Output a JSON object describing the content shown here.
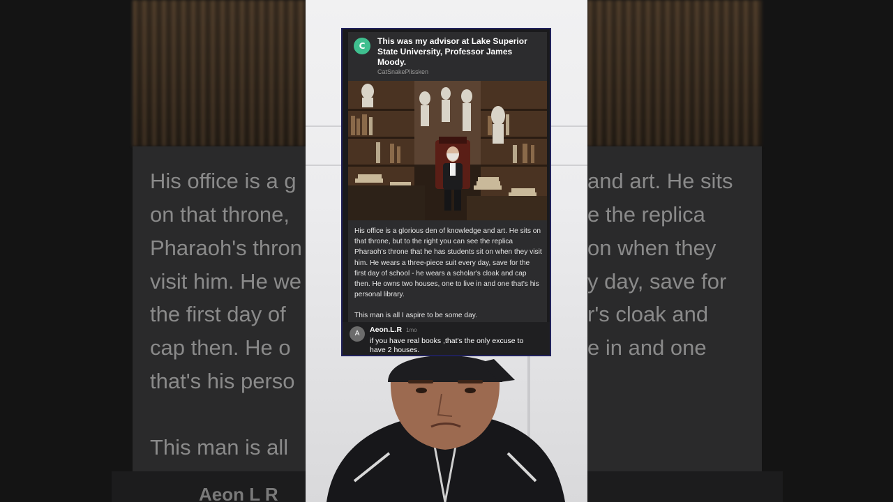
{
  "post": {
    "avatar_letter": "C",
    "title": "This was my advisor at Lake Superior State University, Professor James Moody.",
    "author": "CatSnakePlissken",
    "image_alt": "Professor seated in an office full of books, busts and statues",
    "body_paragraphs": [
      "His office is a glorious den of knowledge and art. He sits on that throne, but to the right you can see the replica Pharaoh's throne that he has students sit on when they visit him. He wears a three-piece suit every day, save for the first day of school - he wears a scholar's cloak and cap then. He owns two houses, one to live in and one that's his personal library.",
      "This man is all I aspire to be some day."
    ]
  },
  "comment": {
    "avatar_letter": "A",
    "username": "Aeon.L.R",
    "time": "1mo",
    "text": "if you have real books ,that's the only excuse to have 2 houses."
  },
  "background_blur": {
    "left_lines": [
      "His office is a g",
      "on that throne,",
      "Pharaoh's thron",
      "visit him. He we",
      "the first day of",
      "cap then. He o",
      "that's his perso"
    ],
    "left_last": "This man is all",
    "left_name": "Aeon L R",
    "right_lines": [
      "and art. He sits",
      "e the replica",
      "on when they",
      "y day, save for",
      "r's cloak and",
      "e in and one"
    ]
  },
  "colors": {
    "avatar_c": "#3fbf8f",
    "card_border": "#20215a",
    "card_bg": "#2c2c2e",
    "comment_bg": "#1f1f21"
  }
}
